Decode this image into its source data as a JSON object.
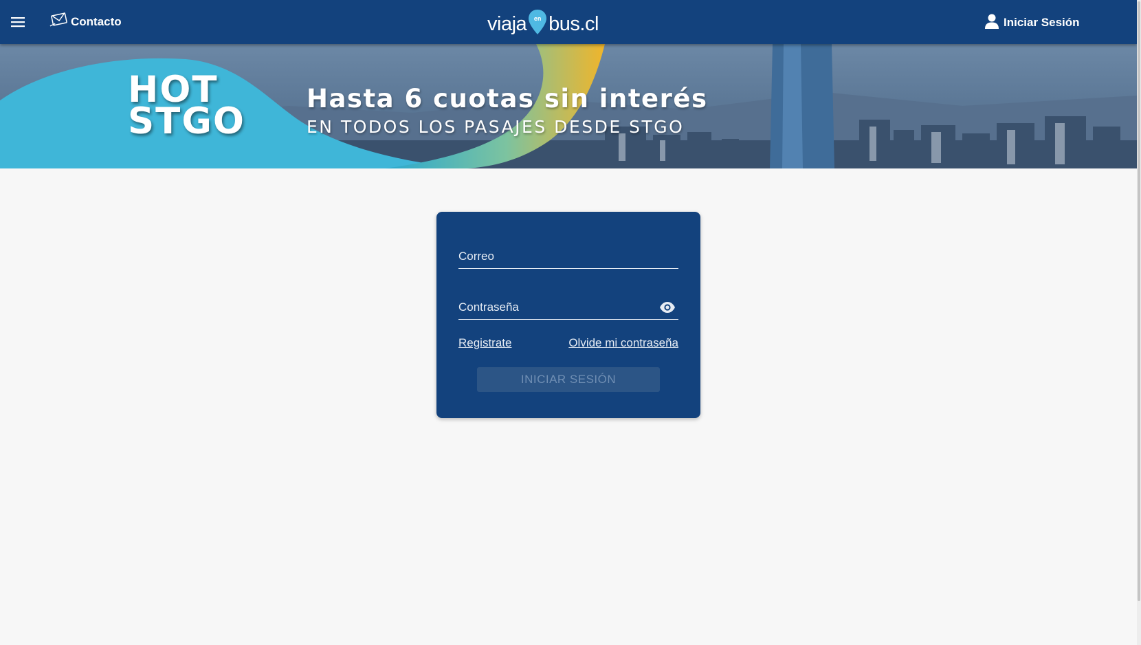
{
  "header": {
    "contact_label": "Contacto",
    "logo": {
      "left": "viaja",
      "pin": "en",
      "right": "bus.cl"
    },
    "login_label": "Iniciar Sesión"
  },
  "banner": {
    "hot_line1": "HOT",
    "hot_line2": "STGO",
    "title": "Hasta 6 cuotas sin interés",
    "subtitle": "EN TODOS LOS PASAJES DESDE STGO"
  },
  "login_form": {
    "email_placeholder": "Correo",
    "email_value": "",
    "password_placeholder": "Contraseña",
    "password_value": "",
    "register_link": "Registrate",
    "forgot_link": "Olvide mi contraseña",
    "submit_label": "INICIAR SESIÓN"
  },
  "colors": {
    "header_bg": "#13427d",
    "card_bg": "#13427d",
    "page_bg": "#f7f7f7",
    "banner_wave_cyan": "#3fb6d8",
    "banner_wave_yellow": "#f0b52b",
    "logo_pin": "#4fb9e3"
  },
  "icons": {
    "menu": "hamburger-icon",
    "contact": "envelope-icon",
    "user": "user-icon",
    "password_toggle": "eye-icon"
  }
}
